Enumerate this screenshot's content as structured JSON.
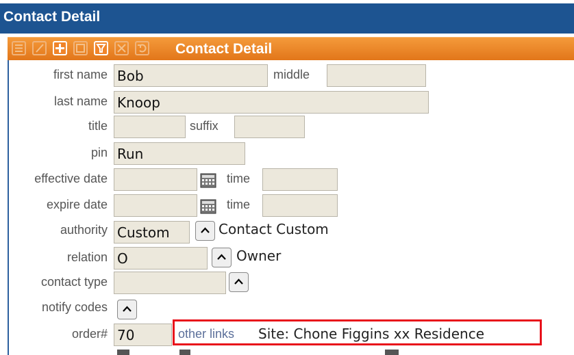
{
  "header": {
    "title": "Contact Detail"
  },
  "toolbar": {
    "title": "Contact Detail",
    "buttons": [
      {
        "icon": "list-icon"
      },
      {
        "icon": "edit-icon"
      },
      {
        "icon": "add-icon"
      },
      {
        "icon": "save-icon"
      },
      {
        "icon": "filter-icon"
      },
      {
        "icon": "delete-icon"
      },
      {
        "icon": "undo-icon"
      }
    ]
  },
  "form": {
    "first_name": {
      "label": "first name",
      "value": "Bob"
    },
    "middle": {
      "label": "middle",
      "value": ""
    },
    "last_name": {
      "label": "last name",
      "value": "Knoop"
    },
    "title": {
      "label": "title",
      "value": ""
    },
    "suffix": {
      "label": "suffix",
      "value": ""
    },
    "pin": {
      "label": "pin",
      "value": "Run"
    },
    "effective_date": {
      "label": "effective date",
      "value": "",
      "time_label": "time",
      "time_value": ""
    },
    "expire_date": {
      "label": "expire date",
      "value": "",
      "time_label": "time",
      "time_value": ""
    },
    "authority": {
      "label": "authority",
      "value": "Custom",
      "description": "Contact Custom"
    },
    "relation": {
      "label": "relation",
      "value": "O",
      "description": "Owner"
    },
    "contact_type": {
      "label": "contact type",
      "value": ""
    },
    "notify_codes": {
      "label": "notify codes"
    },
    "order": {
      "label": "order#",
      "value": "70"
    }
  },
  "other_links": {
    "label": "other links",
    "value": "Site: Chone Figgins xx Residence"
  },
  "colors": {
    "title_bar": "#1d5491",
    "toolbar": "#e8801f",
    "field_bg": "#ece8dc",
    "highlight": "#e8101a"
  }
}
